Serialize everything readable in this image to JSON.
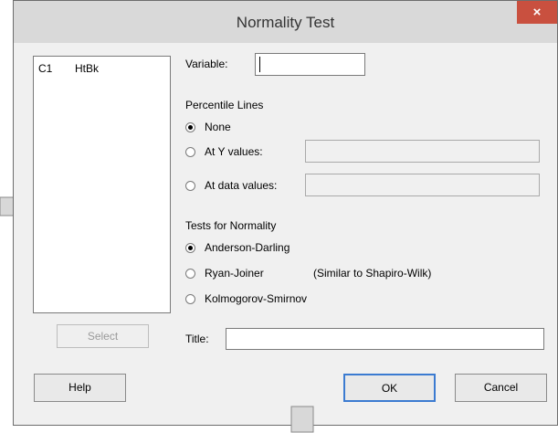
{
  "dialog": {
    "title": "Normality Test",
    "close_label": "×"
  },
  "variable_list": {
    "items": [
      {
        "column": "C1",
        "name": "HtBk"
      }
    ]
  },
  "variable_field": {
    "label": "Variable:",
    "value": ""
  },
  "percentile_lines": {
    "heading": "Percentile Lines",
    "options": [
      {
        "label": "None",
        "checked": true
      },
      {
        "label": "At Y values:",
        "checked": false
      },
      {
        "label": "At data values:",
        "checked": false
      }
    ]
  },
  "tests_for_normality": {
    "heading": "Tests for Normality",
    "options": [
      {
        "label": "Anderson-Darling",
        "checked": true
      },
      {
        "label": "Ryan-Joiner",
        "checked": false,
        "note": "(Similar to Shapiro-Wilk)"
      },
      {
        "label": "Kolmogorov-Smirnov",
        "checked": false
      }
    ]
  },
  "select_button": {
    "label": "Select"
  },
  "title_field": {
    "label": "Title:",
    "value": ""
  },
  "buttons": {
    "help": "Help",
    "ok": "OK",
    "cancel": "Cancel"
  }
}
